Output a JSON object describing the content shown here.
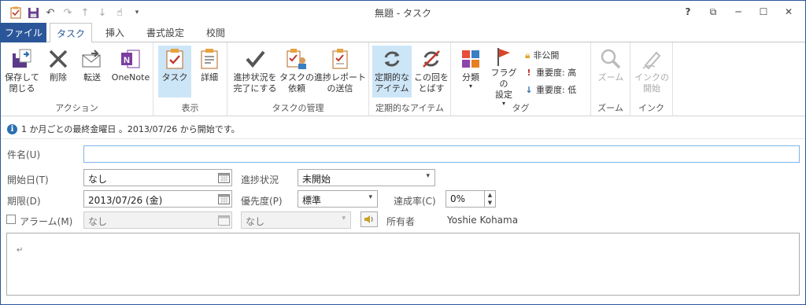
{
  "window": {
    "title": "無題 - タスク"
  },
  "qat": {
    "icons": [
      "task-icon",
      "save-icon",
      "undo-icon",
      "redo-icon",
      "up-icon",
      "down-icon",
      "touch-icon",
      "customize-icon"
    ]
  },
  "window_controls": {
    "help": "?",
    "restore_ribbon": "⧉",
    "minimize": "─",
    "maximize": "☐",
    "close": "✕"
  },
  "tabs": [
    {
      "label": "ファイル"
    },
    {
      "label": "タスク"
    },
    {
      "label": "挿入"
    },
    {
      "label": "書式設定"
    },
    {
      "label": "校閲"
    }
  ],
  "ribbon": {
    "actions": {
      "label": "アクション",
      "save_close": "保存して\n閉じる",
      "delete": "削除",
      "forward": "転送",
      "onenote": "OneNote"
    },
    "show": {
      "label": "表示",
      "task": "タスク",
      "details": "詳細"
    },
    "manage": {
      "label": "タスクの管理",
      "mark_complete": "進捗状況を\n完了にする",
      "assign": "タスクの\n依頼",
      "send_status": "進捗レポート\nの送信"
    },
    "recurrence": {
      "label": "定期的なアイテム",
      "recurrence": "定期的な\nアイテム",
      "skip": "この回を\nとばす"
    },
    "tags": {
      "label": "タグ",
      "categorize": "分類",
      "follow_up": "フラグの\n設定",
      "private": "非公開",
      "high": "重要度: 高",
      "low": "重要度: 低"
    },
    "zoom": {
      "label": "ズーム",
      "zoom": "ズーム"
    },
    "ink": {
      "label": "インク",
      "start": "インクの\n開始"
    }
  },
  "info_bar": {
    "text": "1 か月ごとの最終金曜日 。2013/07/26 から開始です。"
  },
  "form": {
    "subject_label": "件名(U)",
    "subject_value": "",
    "start_label": "開始日(T)",
    "start_value": "なし",
    "status_label": "進捗状況",
    "status_value": "未開始",
    "due_label": "期限(D)",
    "due_value": "2013/07/26 (金)",
    "priority_label": "優先度(P)",
    "priority_value": "標準",
    "percent_label": "達成率(C)",
    "percent_value": "0%",
    "reminder_label": "アラーム(M)",
    "reminder_date": "なし",
    "reminder_time": "なし",
    "owner_label": "所有者",
    "owner_value": "Yoshie Kohama"
  },
  "body": {
    "mark": "↵"
  },
  "colors": {
    "accent": "#2b579a",
    "selected": "#cde6f7"
  }
}
